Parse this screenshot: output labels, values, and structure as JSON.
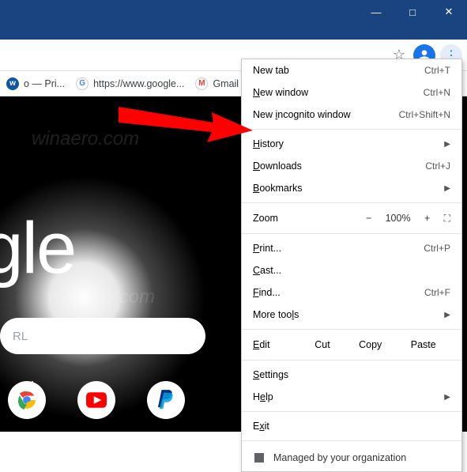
{
  "window": {
    "minimize": "—",
    "maximize": "□",
    "close": "✕"
  },
  "toolbar": {
    "star": "☆",
    "menu_dots": "⋮"
  },
  "bookmarks": {
    "item1": "o — Pri...",
    "item2": "https://www.google...",
    "item3": "Gmail"
  },
  "page": {
    "logo_text": "oogle",
    "search_placeholder": "RL"
  },
  "menu": {
    "new_tab": "New tab",
    "new_tab_sc": "Ctrl+T",
    "new_window": "New window",
    "new_window_sc": "Ctrl+N",
    "incognito": "New incognito window",
    "incognito_sc": "Ctrl+Shift+N",
    "history": "History",
    "downloads": "Downloads",
    "downloads_sc": "Ctrl+J",
    "bookmarks": "Bookmarks",
    "zoom_label": "Zoom",
    "zoom_minus": "−",
    "zoom_value": "100%",
    "zoom_plus": "+",
    "print": "Print...",
    "print_sc": "Ctrl+P",
    "cast": "Cast...",
    "find": "Find...",
    "find_sc": "Ctrl+F",
    "more_tools": "More tools",
    "edit_label": "Edit",
    "cut": "Cut",
    "copy": "Copy",
    "paste": "Paste",
    "settings": "Settings",
    "help": "Help",
    "exit": "Exit",
    "managed": "Managed by your organization"
  },
  "watermark": "winaero.com"
}
